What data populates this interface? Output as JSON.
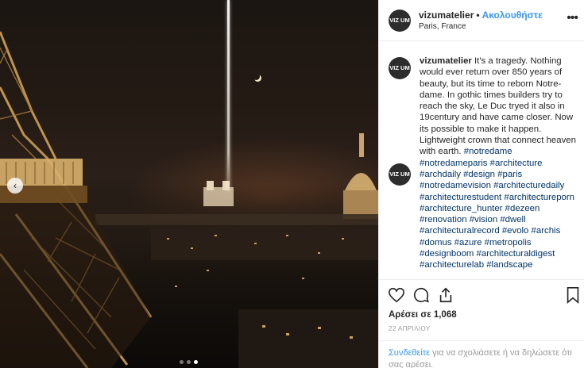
{
  "post": {
    "username": "vizumatelier",
    "follow_label": "Ακολουθήστε",
    "location": "Paris, France",
    "avatar_text": "VIZ UM",
    "caption": "It's a tragedy. Nothing would ever return over 850 years of beauty, but its time to reborn Notre-dame. In gothic times builders try to reach the sky, Le Duc tryed it also in 19century and have came closer. Now its possible to make it happen. Lightweight crown that connect heaven with earth.",
    "hashtags": "#notredame #notredameparis #architecture #archdaily #design #paris #notredamevision #architecturedaily #architecturestudent #architectureporn #architecture_hunter #dezeen #renovation #vision #dwell #architecturalrecord #evolo #archis #domus #azure #metropolis #designboom #architecturaldigest #architecturelab #landscape",
    "likes_label": "Αρέσει σε 1,068",
    "date": "22 ΑΠΡΙΛΙΟΥ",
    "login_link": "Συνδεθείτε",
    "login_text": " για να σχολιάσετε ή να δηλώσετε ότι σας αρέσει."
  },
  "carousel": {
    "slide_count": 3,
    "active_index": 2
  },
  "icons": {
    "more": "more-options-icon",
    "like": "heart-icon",
    "comment": "comment-icon",
    "share": "share-icon",
    "save": "bookmark-icon",
    "prev": "chevron-left-icon"
  },
  "colors": {
    "link": "#3897f0",
    "hashtag": "#003569",
    "text": "#262626",
    "muted": "#999999"
  }
}
